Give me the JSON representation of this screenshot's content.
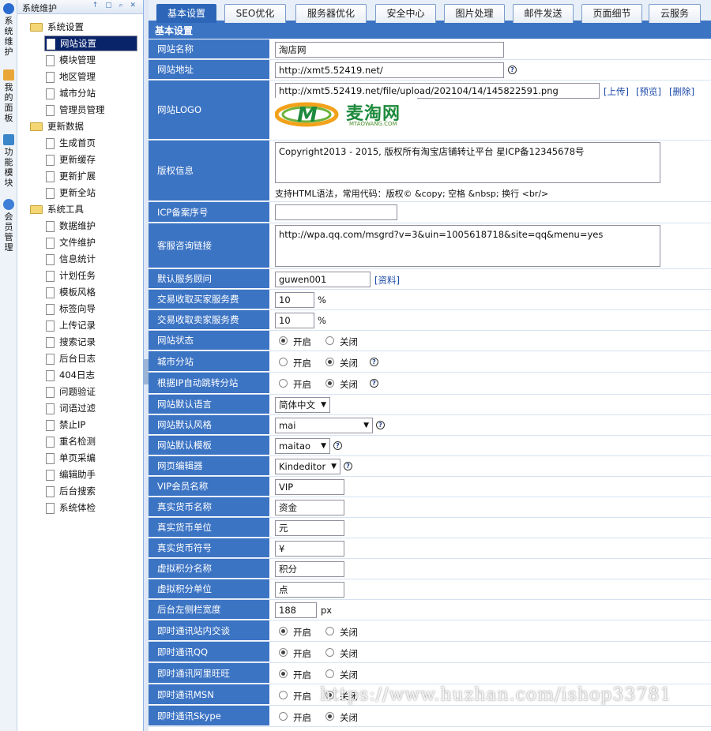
{
  "vtabs": [
    {
      "label": "系统维护",
      "color": "#2a6bd0"
    },
    {
      "label": "我的面板",
      "color": "#e9a73a"
    },
    {
      "label": "功能模块",
      "color": "#3a86c8"
    },
    {
      "label": "会员管理",
      "color": "#3f7fd8"
    }
  ],
  "tree": {
    "title": "系统维护",
    "tools": "↑ ▢ ⌕ ✕",
    "nodes": [
      {
        "type": "folder",
        "label": "系统设置"
      },
      {
        "type": "page",
        "label": "网站设置",
        "selected": true
      },
      {
        "type": "page",
        "label": "模块管理"
      },
      {
        "type": "page",
        "label": "地区管理"
      },
      {
        "type": "page",
        "label": "城市分站"
      },
      {
        "type": "page",
        "label": "管理员管理"
      },
      {
        "type": "folder",
        "label": "更新数据"
      },
      {
        "type": "page",
        "label": "生成首页"
      },
      {
        "type": "page",
        "label": "更新缓存"
      },
      {
        "type": "page",
        "label": "更新扩展"
      },
      {
        "type": "page",
        "label": "更新全站"
      },
      {
        "type": "folder",
        "label": "系统工具"
      },
      {
        "type": "page",
        "label": "数据维护"
      },
      {
        "type": "page",
        "label": "文件维护"
      },
      {
        "type": "page",
        "label": "信息统计"
      },
      {
        "type": "page",
        "label": "计划任务"
      },
      {
        "type": "page",
        "label": "模板风格"
      },
      {
        "type": "page",
        "label": "标签向导"
      },
      {
        "type": "page",
        "label": "上传记录"
      },
      {
        "type": "page",
        "label": "搜索记录"
      },
      {
        "type": "page",
        "label": "后台日志"
      },
      {
        "type": "page",
        "label": "404日志"
      },
      {
        "type": "page",
        "label": "问题验证"
      },
      {
        "type": "page",
        "label": "词语过滤"
      },
      {
        "type": "page",
        "label": "禁止IP"
      },
      {
        "type": "page",
        "label": "重名检测"
      },
      {
        "type": "page",
        "label": "单页采编"
      },
      {
        "type": "page",
        "label": "编辑助手"
      },
      {
        "type": "page",
        "label": "后台搜索"
      },
      {
        "type": "page",
        "label": "系统体检"
      }
    ]
  },
  "tabs": [
    "基本设置",
    "SEO优化",
    "服务器优化",
    "安全中心",
    "图片处理",
    "邮件发送",
    "页面细节",
    "云服务"
  ],
  "section_title": "基本设置",
  "form": {
    "site_name": {
      "label": "网站名称",
      "value": "淘店网"
    },
    "site_url": {
      "label": "网站地址",
      "value": "http://xmt5.52419.net/"
    },
    "site_logo": {
      "label": "网站LOGO",
      "value": "http://xmt5.52419.net/file/upload/202104/14/145822591.png",
      "upload": "[上传]",
      "preview": "[预览]",
      "delete": "[删除]",
      "logo_text": "麦淘网",
      "logo_sub": "MTAOWANG.COM"
    },
    "copyright": {
      "label": "版权信息",
      "value": "Copyright2013 - 2015, 版权所有淘宝店铺转让平台 星ICP备12345678号",
      "hint": "支持HTML语法，常用代码：版权© &copy; 空格 &nbsp; 换行 <br/>"
    },
    "icp": {
      "label": "ICP备案序号",
      "value": ""
    },
    "service_link": {
      "label": "客服咨询链接",
      "value": "http://wpa.qq.com/msgrd?v=3&uin=1005618718&site=qq&menu=yes"
    },
    "default_advisor": {
      "label": "默认服务顾问",
      "value": "guwen001",
      "link": "[资料]"
    },
    "buyer_fee": {
      "label": "交易收取买家服务费",
      "value": "10",
      "unit": "%"
    },
    "seller_fee": {
      "label": "交易收取卖家服务费",
      "value": "10",
      "unit": "%"
    },
    "site_status": {
      "label": "网站状态",
      "on": "开启",
      "off": "关闭",
      "selected": "on"
    },
    "city_station": {
      "label": "城市分站",
      "on": "开启",
      "off": "关闭",
      "selected": "off"
    },
    "ip_redirect": {
      "label": "根据IP自动跳转分站",
      "on": "开启",
      "off": "关闭",
      "selected": "off"
    },
    "language": {
      "label": "网站默认语言",
      "value": "简体中文"
    },
    "style": {
      "label": "网站默认风格",
      "value": "mai"
    },
    "template": {
      "label": "网站默认模板",
      "value": "maitao"
    },
    "editor": {
      "label": "网页编辑器",
      "value": "Kindeditor"
    },
    "vip_name": {
      "label": "VIP会员名称",
      "value": "VIP"
    },
    "money_name": {
      "label": "真实货币名称",
      "value": "资金"
    },
    "money_unit": {
      "label": "真实货币单位",
      "value": "元"
    },
    "money_symbol": {
      "label": "真实货币符号",
      "value": "¥"
    },
    "credit_name": {
      "label": "虚拟积分名称",
      "value": "积分"
    },
    "credit_unit": {
      "label": "虚拟积分单位",
      "value": "点"
    },
    "sidebar_width": {
      "label": "后台左侧栏宽度",
      "value": "188",
      "unit": "px"
    },
    "im_internal": {
      "label": "即时通讯站内交谈",
      "on": "开启",
      "off": "关闭",
      "selected": "on"
    },
    "im_qq": {
      "label": "即时通讯QQ",
      "on": "开启",
      "off": "关闭",
      "selected": "on"
    },
    "im_ww": {
      "label": "即时通讯阿里旺旺",
      "on": "开启",
      "off": "关闭",
      "selected": "on"
    },
    "im_msn": {
      "label": "即时通讯MSN",
      "on": "开启",
      "off": "关闭",
      "selected": "off"
    },
    "im_skype": {
      "label": "即时通讯Skype",
      "on": "开启",
      "off": "关闭",
      "selected": "off"
    }
  },
  "watermark": "https://www.huzhan.com/ishop33781"
}
